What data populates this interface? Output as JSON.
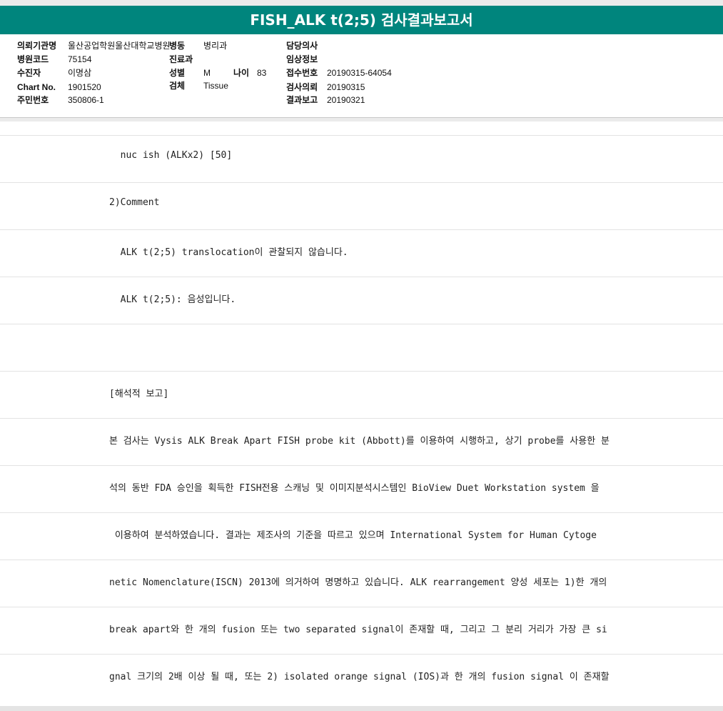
{
  "title": "FISH_ALK t(2;5) 검사결과보고서",
  "patient": {
    "institution_label": "의뢰기관명",
    "institution_value": "울산공업학원울산대학교병원",
    "ward_label": "병동",
    "ward_value": "병리과",
    "doctor_label": "담당의사",
    "doctor_value": "",
    "hospital_code_label": "병원코드",
    "hospital_code_value": "75154",
    "department_label": "진료과",
    "department_value": "",
    "clinical_info_label": "임상정보",
    "clinical_info_value": "",
    "examinee_label": "수진자",
    "examinee_value": "이명삼",
    "sex_label": "성별",
    "sex_value": "M",
    "age_label": "나이",
    "age_value": "83",
    "receipt_no_label": "접수번호",
    "receipt_no_value": "20190315-64054",
    "chart_label": "Chart No.",
    "chart_value": "1901520",
    "specimen_label": "검체",
    "specimen_value": "Tissue",
    "request_date_label": "검사의뢰",
    "request_date_value": "20190315",
    "id_label": "주민번호",
    "id_value": "350806-1",
    "report_date_label": "결과보고",
    "report_date_value": "20190321"
  },
  "report": {
    "lines": [
      "  nuc ish (ALKx2) [50]",
      "2)Comment",
      "  ALK t(2;5) translocation이 관찰되지 않습니다.",
      "  ALK t(2;5): 음성입니다.",
      "",
      "[해석적 보고]",
      "본 검사는 Vysis ALK Break Apart FISH probe kit (Abbott)를 이용하여 시행하고, 상기 probe를 사용한 분",
      "석의 동반 FDA 승인을 획득한 FISH전용 스캐닝 및 이미지분석시스템인 BioView Duet Workstation system 을",
      " 이용하여 분석하였습니다. 결과는 제조사의 기준을 따르고 있으며 International System for Human Cytoge",
      "netic Nomenclature(ISCN) 2013에 의거하여 명명하고 있습니다. ALK rearrangement 양성 세포는 1)한 개의",
      "break apart와 한 개의 fusion 또는 two separated signal이 존재할 때, 그리고 그 분리 거리가 가장 큰 si",
      "gnal 크기의 2배 이상 될 때, 또는 2) isolated orange signal (IOS)과 한 개의 fusion signal 이 존재할"
    ]
  }
}
